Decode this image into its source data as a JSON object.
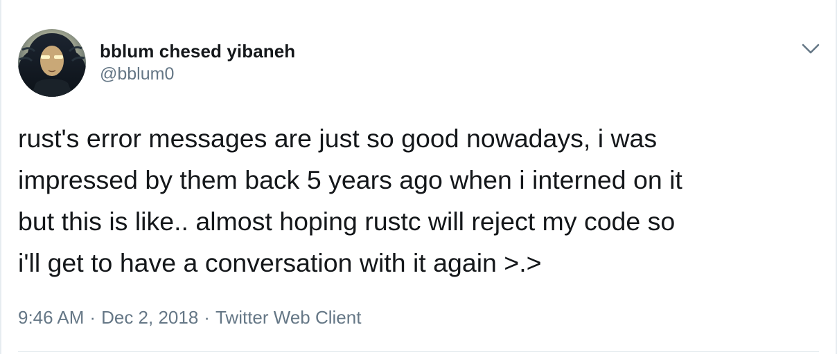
{
  "tweet": {
    "author": {
      "display_name": "bblum chesed yibaneh",
      "handle": "@bblum0",
      "avatar_icon": "avatar-image"
    },
    "menu_icon": "chevron-down-icon",
    "text": "rust's error messages are just so good nowadays, i was\nimpressed by them back 5 years ago when i interned on it\nbut this is like.. almost hoping rustc will reject my code so\ni'll get to have a conversation with it again >.>",
    "meta": {
      "time": "9:46 AM",
      "separator": "·",
      "date": "Dec 2, 2018",
      "source": "Twitter Web Client"
    }
  },
  "colors": {
    "text_primary": "#14171a",
    "text_secondary": "#657786",
    "border": "#e6ecf0",
    "background": "#ffffff"
  }
}
